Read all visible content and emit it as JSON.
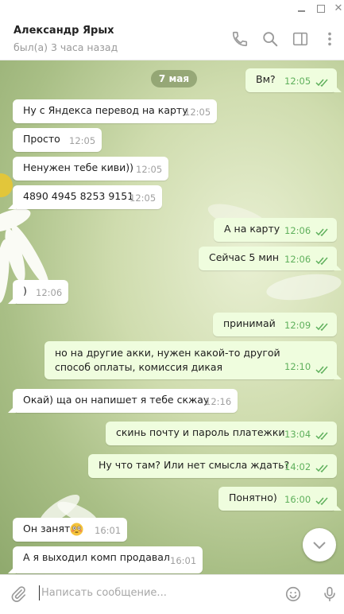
{
  "peer": {
    "name": "Александр Ярых",
    "status": "был(а) 3 часа назад"
  },
  "date_separator": "7 мая",
  "messages": [
    {
      "dir": "out",
      "text": "Вм?",
      "time": "12:05"
    },
    {
      "dir": "in",
      "text": "Ну с Яндекса перевод на карту",
      "time": "12:05"
    },
    {
      "dir": "in",
      "text": "Просто",
      "time": "12:05"
    },
    {
      "dir": "in",
      "text": "Ненужен тебе киви))",
      "time": "12:05"
    },
    {
      "dir": "in",
      "text": "4890 4945 8253 9151",
      "time": "12:05"
    },
    {
      "dir": "out",
      "text": "А на карту",
      "time": "12:06"
    },
    {
      "dir": "out",
      "text": "Сейчас 5 мин",
      "time": "12:06"
    },
    {
      "dir": "in",
      "text": ")",
      "time": "12:06"
    },
    {
      "dir": "out",
      "text": "принимай",
      "time": "12:09"
    },
    {
      "dir": "out",
      "text": "но на другие акки, нужен какой-то другой способ оплаты, комиссия дикая",
      "time": "12:10"
    },
    {
      "dir": "in",
      "text": "Окай) ща он напишет я тебе скжау",
      "time": "12:16"
    },
    {
      "dir": "out",
      "text": "скинь почту и пароль платежки",
      "time": "13:04"
    },
    {
      "dir": "out",
      "text": "Ну что там? Или нет смысла ждать?",
      "time": "14:02"
    },
    {
      "dir": "out",
      "text": "Понятно)",
      "time": "16:00"
    },
    {
      "dir": "in",
      "text": "Он занят",
      "emoji": "flushed-face-emoji",
      "time": "16:01"
    },
    {
      "dir": "in",
      "text": "А я выходил комп продавал",
      "time": "16:01"
    }
  ],
  "composer": {
    "placeholder": "Написать сообщение..."
  },
  "colors": {
    "incoming_bubble": "#ffffff",
    "outgoing_bubble": "#effdde",
    "outgoing_time": "#5fb05c",
    "icon_gray": "#999999"
  },
  "icons": [
    "phone-icon",
    "search-icon",
    "sidebar-toggle-icon",
    "more-vertical-icon",
    "attach-icon",
    "emoji-icon",
    "microphone-icon",
    "chevron-down-icon",
    "double-check-icon"
  ]
}
